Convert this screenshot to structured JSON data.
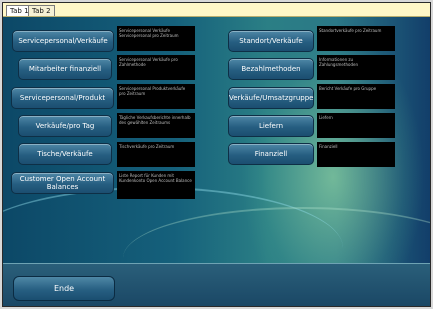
{
  "tabs": [
    "Tab 1",
    "Tab 2"
  ],
  "left_buttons": [
    {
      "label": "Servicepersonal/Verkäufe",
      "description": "Servicepersonal Verkäufe Servicepersonal pro Zeitraum"
    },
    {
      "label": "Mitarbeiter finanziell",
      "description": "Servicepersonal Verkäufe pro Zahlmethode"
    },
    {
      "label": "Servicepersonal/Produkt",
      "description": "Servicepersonal Produktverkäufe pro Zeitraum"
    },
    {
      "label": "Verkäufe/pro Tag",
      "description": "Tägliche Verkaufsberichte innerhalb des gewählten Zeitraums"
    },
    {
      "label": "Tische/Verkäufe",
      "description": "Tischverkäufe pro Zeitraum"
    },
    {
      "label": "Customer Open Account Balances",
      "description": "Liste Report für Kunden mit Kundenkonto Open Account Balance"
    }
  ],
  "right_buttons": [
    {
      "label": "Standort/Verkäufe",
      "description": "Standortverkäufe pro Zeitraum"
    },
    {
      "label": "Bezahlmethoden",
      "description": "Informationen zu Zahlungsmethoden"
    },
    {
      "label": "Verkäufe/Umsatzgruppen",
      "description": "Bericht Verkäufe pro Gruppe"
    },
    {
      "label": "Liefern",
      "description": "Liefern"
    },
    {
      "label": "Finanziell",
      "description": "Finanziell"
    }
  ],
  "bottom": {
    "ende_label": "Ende"
  }
}
